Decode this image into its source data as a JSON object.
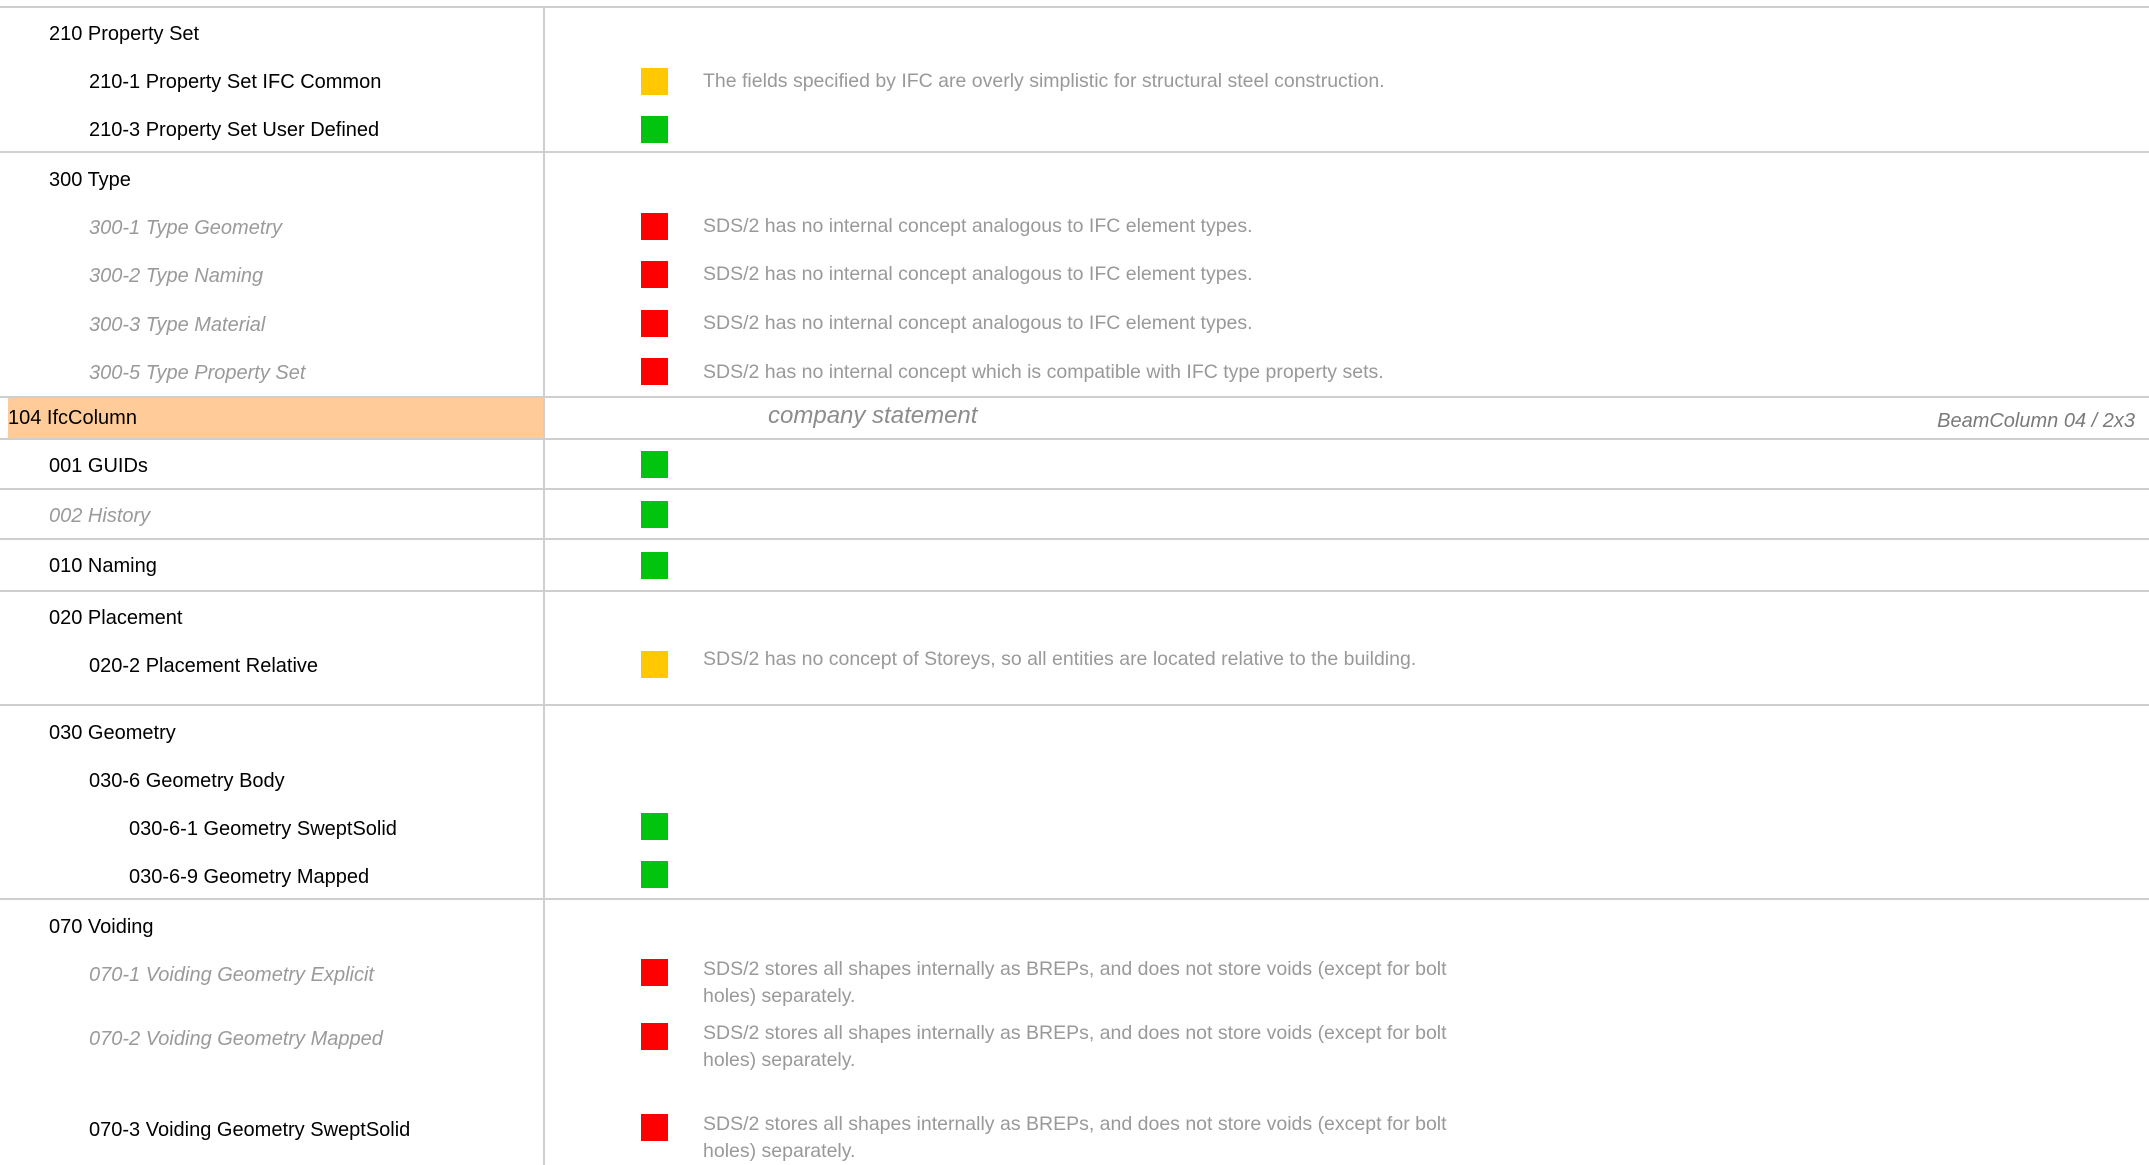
{
  "sections": [
    {
      "label": "210 Property Set",
      "inactive": false
    },
    {
      "label": "210-1 Property Set IFC Common",
      "inactive": false,
      "status": "yellow",
      "comment": "The fields specified by IFC are overly simplistic for structural steel construction."
    },
    {
      "label": "210-3 Property Set User Defined",
      "inactive": false,
      "status": "green"
    },
    {
      "label": "300 Type",
      "inactive": false
    },
    {
      "label": "300-1 Type Geometry",
      "inactive": true,
      "status": "red",
      "comment": "SDS/2 has no internal concept analogous to IFC element types."
    },
    {
      "label": "300-2 Type Naming",
      "inactive": true,
      "status": "red",
      "comment": "SDS/2 has no internal concept analogous to IFC element types."
    },
    {
      "label": "300-3 Type Material",
      "inactive": true,
      "status": "red",
      "comment": "SDS/2 has no internal concept analogous to IFC element types."
    },
    {
      "label": "300-5 Type Property Set",
      "inactive": true,
      "status": "red",
      "comment": "SDS/2 has no internal concept which is compatible with IFC type property sets."
    }
  ],
  "entity": {
    "name": "104 IfcColumn",
    "sub_header": "company statement",
    "right_label": "BeamColumn 04 / 2x3"
  },
  "entity_rows": [
    {
      "label": "001 GUIDs",
      "inactive": false,
      "status": "green"
    },
    {
      "label": "002 History",
      "inactive": true,
      "status": "green"
    },
    {
      "label": "010 Naming",
      "inactive": false,
      "status": "green"
    },
    {
      "label": "020 Placement",
      "inactive": false
    },
    {
      "label": "020-2 Placement Relative",
      "inactive": false,
      "status": "yellow",
      "comment": "SDS/2 has no concept of Storeys, so all entities are located relative to the building."
    },
    {
      "label": "030 Geometry",
      "inactive": false
    },
    {
      "label": "030-6 Geometry Body",
      "inactive": false
    },
    {
      "label": "030-6-1 Geometry SweptSolid",
      "inactive": false,
      "status": "green"
    },
    {
      "label": "030-6-9 Geometry Mapped",
      "inactive": false,
      "status": "green"
    },
    {
      "label": "070 Voiding",
      "inactive": false
    },
    {
      "label": "070-1 Voiding Geometry Explicit",
      "inactive": true,
      "status": "red",
      "comment": "SDS/2 stores all shapes internally as BREPs, and does not store voids (except for bolt holes) separately."
    },
    {
      "label": "070-2 Voiding Geometry Mapped",
      "inactive": true,
      "status": "red",
      "comment": "SDS/2 stores all shapes internally as BREPs, and does not store voids (except for bolt holes) separately."
    },
    {
      "label": "070-3 Voiding Geometry SweptSolid",
      "inactive": false,
      "status": "red",
      "comment": "SDS/2 stores all shapes internally as BREPs, and does not store voids (except for bolt holes) separately."
    }
  ]
}
